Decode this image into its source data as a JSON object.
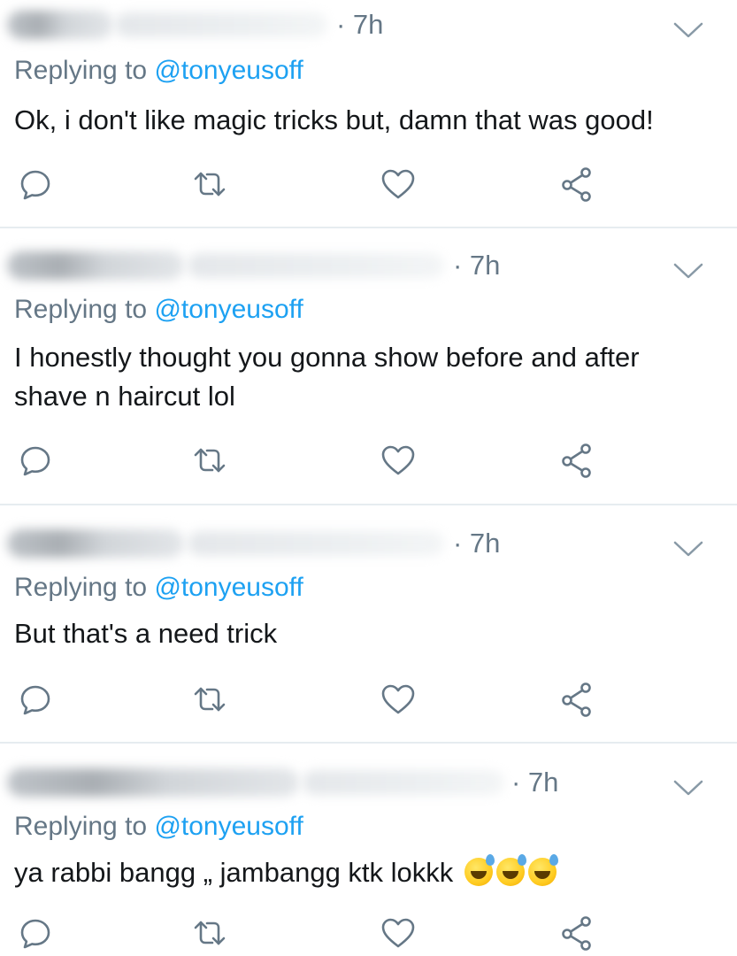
{
  "tweets": [
    {
      "time": "· 7h",
      "replying_prefix": "Replying to ",
      "replying_handle": "@tonyeusoff",
      "text": "Ok, i don't like magic tricks but, damn that was good!"
    },
    {
      "time": "· 7h",
      "replying_prefix": "Replying to ",
      "replying_handle": "@tonyeusoff",
      "text": "I honestly thought you gonna show before and after shave n haircut lol"
    },
    {
      "time": "· 7h",
      "replying_prefix": "Replying to ",
      "replying_handle": "@tonyeusoff",
      "text": "But that's a need trick"
    },
    {
      "time": "· 7h",
      "replying_prefix": "Replying to ",
      "replying_handle": "@tonyeusoff",
      "text": "ya rabbi bangg „ jambangg ktk lokkk",
      "emojis": [
        "sweat-smile-emoji",
        "sweat-smile-emoji",
        "sweat-smile-emoji"
      ]
    }
  ],
  "icons": {
    "reply": "reply-icon",
    "retweet": "retweet-icon",
    "like": "heart-icon",
    "share": "share-icon",
    "more": "chevron-down-icon"
  },
  "colors": {
    "text": "#14171a",
    "secondary": "#657786",
    "link": "#1da1f2",
    "icon": "#657786",
    "divider": "#e6ecf0"
  }
}
